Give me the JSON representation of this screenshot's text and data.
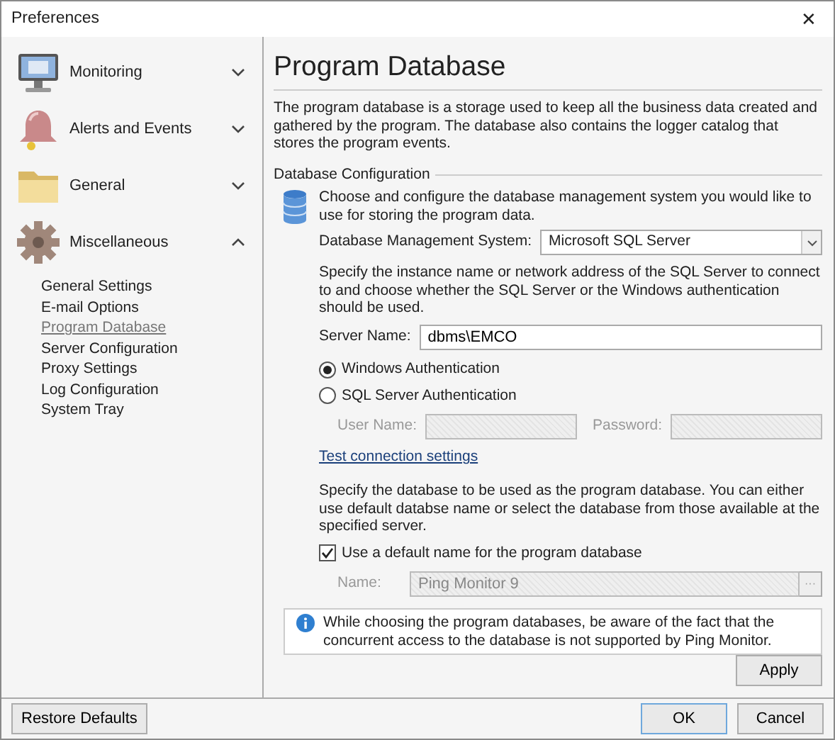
{
  "window": {
    "title": "Preferences",
    "close": "✕"
  },
  "sidebar": {
    "groups": [
      {
        "label": "Monitoring",
        "kind": "monitor",
        "expanded": false
      },
      {
        "label": "Alerts and Events",
        "kind": "bell",
        "expanded": false
      },
      {
        "label": "General",
        "kind": "folder",
        "expanded": false
      },
      {
        "label": "Miscellaneous",
        "kind": "gear",
        "expanded": true,
        "items": [
          {
            "label": "General Settings",
            "selected": false
          },
          {
            "label": "E-mail Options",
            "selected": false
          },
          {
            "label": "Program Database",
            "selected": true
          },
          {
            "label": "Server Configuration",
            "selected": false
          },
          {
            "label": "Proxy Settings",
            "selected": false
          },
          {
            "label": "Log Configuration",
            "selected": false
          },
          {
            "label": "System Tray",
            "selected": false
          }
        ]
      }
    ]
  },
  "page": {
    "title": "Program Database",
    "description": "The program database is a storage used to keep all the business data created and gathered by the program. The database also contains the logger catalog that stores the program events.",
    "section": "Database Configuration",
    "intro": "Choose and configure the database management system you would like to use for storing the program data.",
    "dbms": {
      "label": "Database Management System:",
      "value": "Microsoft SQL Server"
    },
    "server_hint": "Specify the instance name or network address of the SQL Server to connect to and choose whether the SQL Server or the Windows authentication should be used.",
    "server_name": {
      "label": "Server Name:",
      "value": "dbms\\EMCO"
    },
    "auth_options": [
      {
        "label": "Windows Authentication",
        "selected": true
      },
      {
        "label": "SQL Server Authentication",
        "selected": false
      }
    ],
    "credentials": [
      {
        "label": "User Name:",
        "disabled": true
      },
      {
        "label": "Password:",
        "disabled": true
      }
    ],
    "test_link": "Test connection settings",
    "database_hint": "Specify the database to be used as the program database. You can either use default databse name or select the database from those available at the specified server.",
    "default_name": {
      "label": "Use a default name for the program database",
      "checked": true
    },
    "name_field": {
      "label": "Name:",
      "value": "Ping Monitor 9",
      "disabled": true,
      "browse": "···"
    },
    "info": "While choosing the program databases, be aware of the fact that the concurrent access to the database is not supported by Ping Monitor.",
    "apply": "Apply"
  },
  "footer": {
    "restore": "Restore Defaults",
    "ok": "OK",
    "cancel": "Cancel"
  }
}
